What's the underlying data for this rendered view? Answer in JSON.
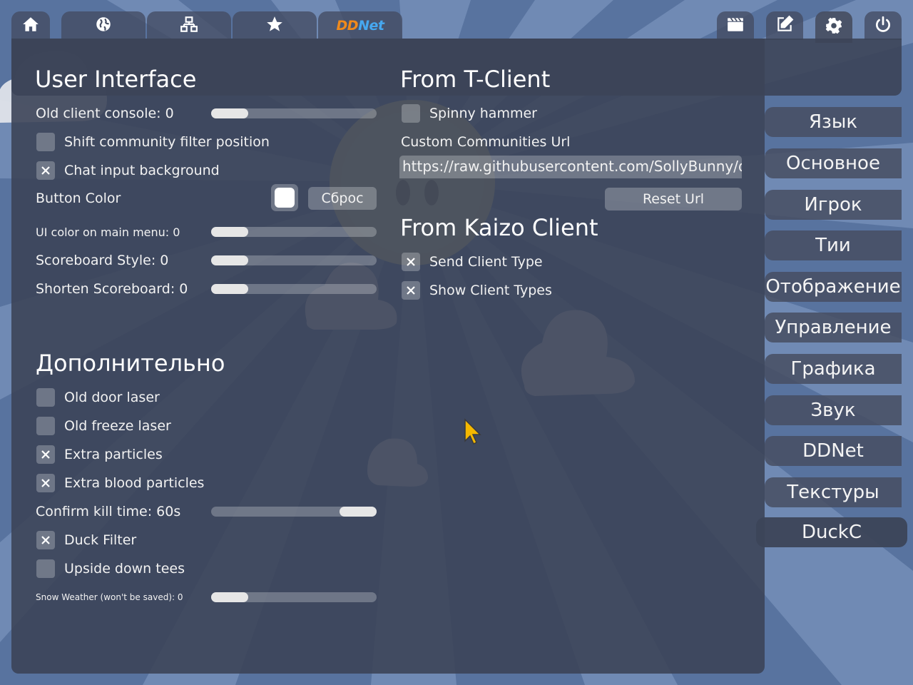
{
  "top_tabs": {
    "left": [
      {
        "name": "home-icon"
      },
      {
        "name": "globe-icon"
      },
      {
        "name": "network-icon"
      },
      {
        "name": "star-icon"
      },
      {
        "name": "ddnet-logo",
        "text_dd": "DD",
        "text_net": "Net"
      }
    ],
    "right": [
      {
        "name": "clapperboard-icon"
      },
      {
        "name": "edit-icon"
      },
      {
        "name": "gear-icon",
        "active": true
      },
      {
        "name": "power-icon"
      }
    ]
  },
  "user_interface": {
    "title": "User Interface",
    "old_console": {
      "label": "Old client console: 0",
      "value": 0
    },
    "shift_filter": {
      "label": "Shift community filter position",
      "checked": false
    },
    "chat_bg": {
      "label": "Chat input background",
      "checked": true
    },
    "button_color": {
      "label": "Button Color",
      "color": "#ffffff",
      "reset_label": "Сброс"
    },
    "ui_color": {
      "label": "UI color on main menu: 0",
      "value": 0
    },
    "scoreboard_style": {
      "label": "Scoreboard Style: 0",
      "value": 0
    },
    "shorten_scoreboard": {
      "label": "Shorten Scoreboard: 0",
      "value": 0
    }
  },
  "extra": {
    "title": "Дополнительно",
    "old_door_laser": {
      "label": "Old door laser",
      "checked": false
    },
    "old_freeze_laser": {
      "label": "Old freeze laser",
      "checked": false
    },
    "extra_particles": {
      "label": "Extra particles",
      "checked": true
    },
    "extra_blood": {
      "label": "Extra blood particles",
      "checked": true
    },
    "confirm_kill": {
      "label": "Confirm kill time: 60s",
      "value": 1.0
    },
    "duck_filter": {
      "label": "Duck Filter",
      "checked": true
    },
    "upside_down": {
      "label": "Upside down tees",
      "checked": false
    },
    "snow_weather": {
      "label": "Snow Weather (won't be saved): 0",
      "value": 0
    }
  },
  "t_client": {
    "title": "From T-Client",
    "spinny_hammer": {
      "label": "Spinny hammer",
      "checked": false
    },
    "communities_url_label": "Custom Communities Url",
    "communities_url_value": "https://raw.githubusercontent.com/SollyBunny/ddnet-custom-communities/main/custom-communities-ddnet-info.json",
    "reset_url_label": "Reset Url"
  },
  "kaizo": {
    "title": "From Kaizo Client",
    "send_client_type": {
      "label": "Send Client Type",
      "checked": true
    },
    "show_client_types": {
      "label": "Show Client Types",
      "checked": true
    }
  },
  "sidebar": {
    "items": [
      {
        "label": "Язык"
      },
      {
        "label": "Основное"
      },
      {
        "label": "Игрок"
      },
      {
        "label": "Тии"
      },
      {
        "label": "Отображение"
      },
      {
        "label": "Управление"
      },
      {
        "label": "Графика"
      },
      {
        "label": "Звук"
      },
      {
        "label": "DDNet"
      },
      {
        "label": "Текстуры"
      },
      {
        "label": "DuckC",
        "active": true
      }
    ]
  },
  "colors": {
    "sky": "#4f6a9a",
    "panel": "#3c4458",
    "ddnet_orange": "#f08a1c",
    "ddnet_blue": "#46a8f0",
    "cursor": "#f5b800"
  }
}
